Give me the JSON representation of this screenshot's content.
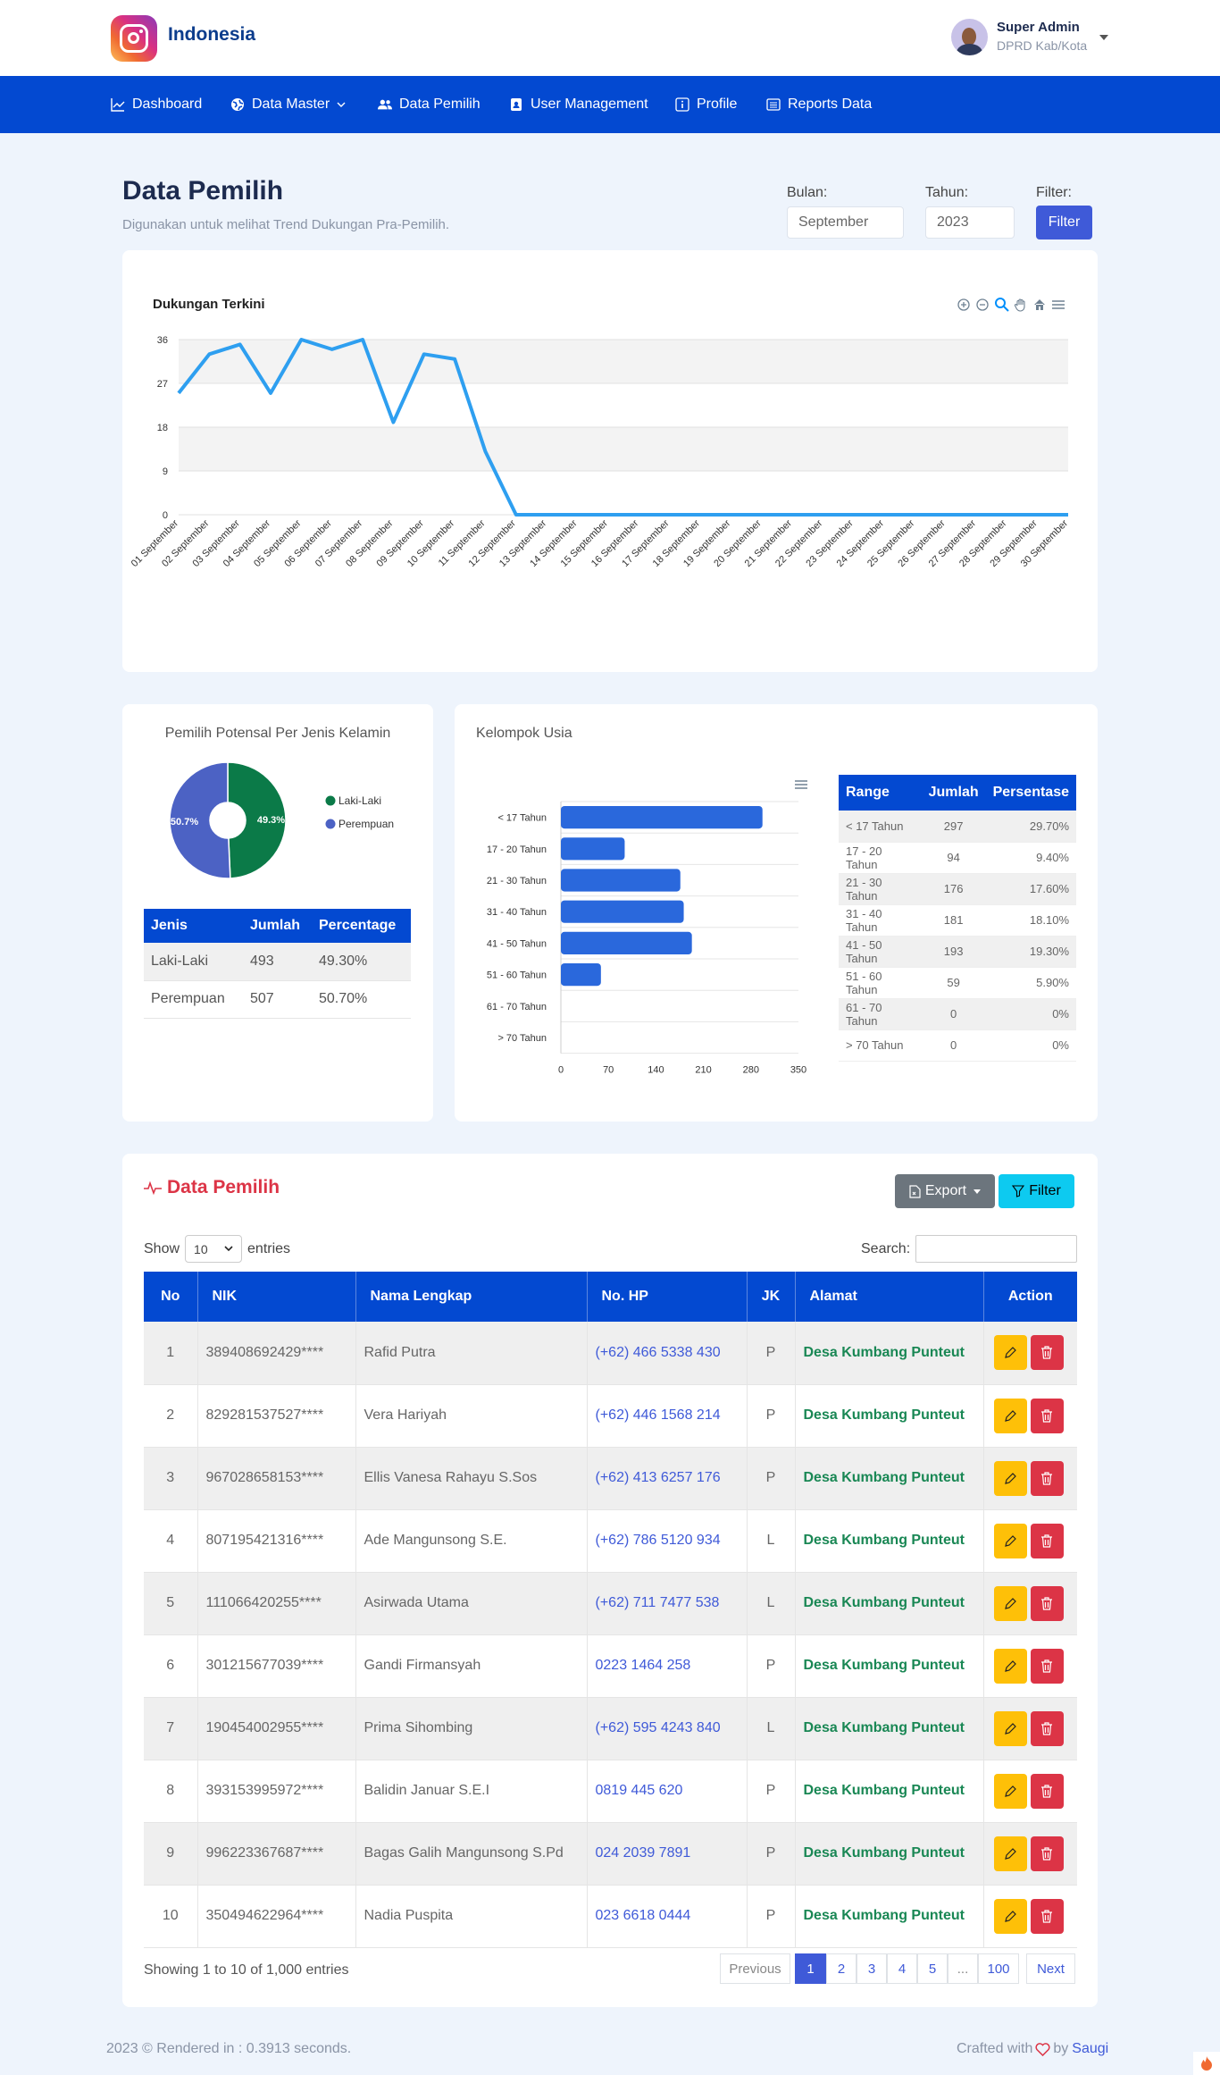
{
  "header": {
    "brand": "Indonesia",
    "user_name": "Super Admin",
    "user_role": "DPRD Kab/Kota"
  },
  "nav": {
    "items": [
      {
        "label": "Dashboard",
        "icon": "chart-line-icon"
      },
      {
        "label": "Data Master",
        "icon": "globe-icon"
      },
      {
        "label": "Data Pemilih",
        "icon": "users-icon"
      },
      {
        "label": "User Management",
        "icon": "id-badge-icon"
      },
      {
        "label": "Profile",
        "icon": "info-icon"
      },
      {
        "label": "Reports Data",
        "icon": "list-icon"
      }
    ]
  },
  "page": {
    "title": "Data Pemilih",
    "subtitle": "Digunakan untuk melihat Trend Dukungan Pra-Pemilih.",
    "bulan_label": "Bulan:",
    "bulan_value": "September",
    "tahun_label": "Tahun:",
    "tahun_value": "2023",
    "filter_label": "Filter:",
    "filter_button": "Filter"
  },
  "chart_data": [
    {
      "type": "line",
      "title": "Dukungan Terkini",
      "x": [
        "01 September",
        "02 September",
        "03 September",
        "04 September",
        "05 September",
        "06 September",
        "07 September",
        "08 September",
        "09 September",
        "10 September",
        "11 September",
        "12 September",
        "13 September",
        "14 September",
        "15 September",
        "16 September",
        "17 September",
        "18 September",
        "19 September",
        "20 September",
        "21 September",
        "22 September",
        "23 September",
        "24 September",
        "25 September",
        "26 September",
        "27 September",
        "28 September",
        "29 September",
        "30 September"
      ],
      "y": [
        25,
        33,
        35,
        25,
        36,
        34,
        36,
        19,
        33,
        32,
        13,
        0,
        0,
        0,
        0,
        0,
        0,
        0,
        0,
        0,
        0,
        0,
        0,
        0,
        0,
        0,
        0,
        0,
        0,
        0
      ],
      "ylim": [
        0,
        36
      ],
      "yticks": [
        0,
        9,
        18,
        27,
        36
      ],
      "color": "#2e9ff0"
    },
    {
      "type": "pie",
      "title": "Pemilih Potensal Per Jenis Kelamin",
      "labels": [
        "Laki-Laki",
        "Perempuan"
      ],
      "values": [
        49.3,
        50.7
      ],
      "data_labels": [
        "49.3%",
        "50.7%"
      ],
      "colors": [
        "#0b7a48",
        "#4c62c4"
      ],
      "legend": "right"
    },
    {
      "type": "bar",
      "orientation": "horizontal",
      "title": "Kelompok Usia",
      "categories": [
        "< 17 Tahun",
        "17 - 20 Tahun",
        "21 - 30 Tahun",
        "31 - 40 Tahun",
        "41 - 50 Tahun",
        "51 - 60 Tahun",
        "61 - 70 Tahun",
        "> 70 Tahun"
      ],
      "values": [
        297,
        94,
        176,
        181,
        193,
        59,
        0,
        0
      ],
      "xlim": [
        0,
        350
      ],
      "xticks": [
        0,
        70,
        140,
        210,
        280,
        350
      ],
      "color": "#2a68dc"
    }
  ],
  "gender_table": {
    "headers": [
      "Jenis",
      "Jumlah",
      "Percentage"
    ],
    "rows": [
      [
        "Laki-Laki",
        "493",
        "49.30%"
      ],
      [
        "Perempuan",
        "507",
        "50.70%"
      ]
    ]
  },
  "age_table": {
    "headers": [
      "Range",
      "Jumlah",
      "Persentase"
    ],
    "rows": [
      [
        "< 17 Tahun",
        "297",
        "29.70%"
      ],
      [
        "17 - 20 Tahun",
        "94",
        "9.40%"
      ],
      [
        "21 - 30 Tahun",
        "176",
        "17.60%"
      ],
      [
        "31 - 40 Tahun",
        "181",
        "18.10%"
      ],
      [
        "41 - 50 Tahun",
        "193",
        "19.30%"
      ],
      [
        "51 - 60 Tahun",
        "59",
        "5.90%"
      ],
      [
        "61 - 70 Tahun",
        "0",
        "0%"
      ],
      [
        "> 70 Tahun",
        "0",
        "0%"
      ]
    ]
  },
  "list": {
    "title": "Data Pemilih",
    "export_label": "Export",
    "filter_label": "Filter",
    "show_label": "Show",
    "entries_value": "10",
    "entries_label": "entries",
    "search_label": "Search:",
    "headers": [
      "No",
      "NIK",
      "Nama Lengkap",
      "No. HP",
      "JK",
      "Alamat",
      "Action"
    ],
    "rows": [
      [
        "1",
        "389408692429****",
        "Rafid Putra",
        "(+62) 466 5338 430",
        "P",
        "Desa Kumbang Punteut"
      ],
      [
        "2",
        "829281537527****",
        "Vera Hariyah",
        "(+62) 446 1568 214",
        "P",
        "Desa Kumbang Punteut"
      ],
      [
        "3",
        "967028658153****",
        "Ellis Vanesa Rahayu S.Sos",
        "(+62) 413 6257 176",
        "P",
        "Desa Kumbang Punteut"
      ],
      [
        "4",
        "807195421316****",
        "Ade Mangunsong S.E.",
        "(+62) 786 5120 934",
        "L",
        "Desa Kumbang Punteut"
      ],
      [
        "5",
        "111066420255****",
        "Asirwada Utama",
        "(+62) 711 7477 538",
        "L",
        "Desa Kumbang Punteut"
      ],
      [
        "6",
        "301215677039****",
        "Gandi Firmansyah",
        "0223 1464 258",
        "P",
        "Desa Kumbang Punteut"
      ],
      [
        "7",
        "190454002955****",
        "Prima Sihombing",
        "(+62) 595 4243 840",
        "L",
        "Desa Kumbang Punteut"
      ],
      [
        "8",
        "393153995972****",
        "Balidin Januar S.E.I",
        "0819 445 620",
        "P",
        "Desa Kumbang Punteut"
      ],
      [
        "9",
        "996223367687****",
        "Bagas Galih Mangunsong S.Pd",
        "024 2039 7891",
        "P",
        "Desa Kumbang Punteut"
      ],
      [
        "10",
        "350494622964****",
        "Nadia Puspita",
        "023 6618 0444",
        "P",
        "Desa Kumbang Punteut"
      ]
    ],
    "info": "Showing 1 to 10 of 1,000 entries",
    "pagination": [
      "Previous",
      "1",
      "2",
      "3",
      "4",
      "5",
      "...",
      "100",
      "Next"
    ]
  },
  "footer": {
    "left": "2023 © Rendered in : 0.3913 seconds.",
    "crafted": "Crafted with",
    "by": "by",
    "author": "Saugi"
  }
}
